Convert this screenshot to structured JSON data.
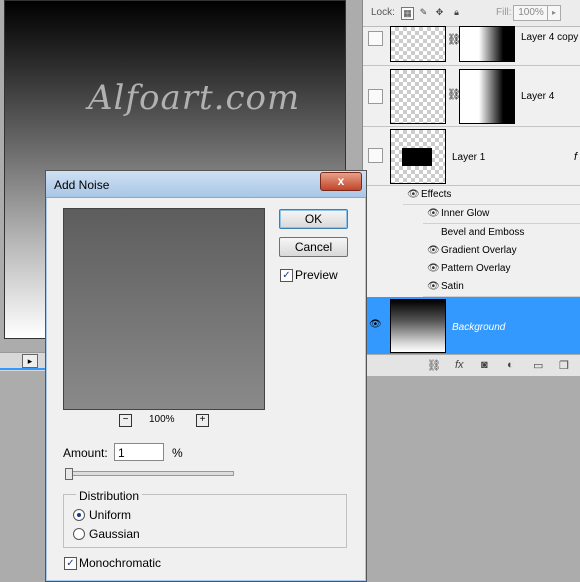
{
  "canvas": {
    "watermark": "Alfoart.com"
  },
  "layers_panel": {
    "lock_label": "Lock:",
    "fill_label": "Fill:",
    "fill_value": "100%",
    "layers": [
      {
        "name": "Layer 4 copy"
      },
      {
        "name": "Layer 4"
      },
      {
        "name": "Layer 1"
      },
      {
        "name": "Background"
      }
    ],
    "effects_label": "Effects",
    "effects": [
      "Inner Glow",
      "Bevel and Emboss",
      "Gradient Overlay",
      "Pattern Overlay",
      "Satin"
    ],
    "bottom_icons": [
      "link-icon",
      "fx-icon",
      "mask-icon",
      "adjustment-icon",
      "folder-icon",
      "new-layer-icon"
    ],
    "fx_text": "fx"
  },
  "dialog": {
    "title": "Add Noise",
    "close_symbol": "x",
    "ok_label": "OK",
    "cancel_label": "Cancel",
    "preview_label": "Preview",
    "preview_checked": true,
    "zoom_out": "−",
    "zoom_in": "+",
    "zoom_level": "100%",
    "amount_label": "Amount:",
    "amount_value": "1",
    "amount_unit": "%",
    "distribution_label": "Distribution",
    "distribution_options": [
      "Uniform",
      "Gaussian"
    ],
    "distribution_selected": "Uniform",
    "monochromatic_label": "Monochromatic",
    "monochromatic_checked": true
  },
  "colors": {
    "selection": "#3399ff",
    "dialog_bg": "#f0f0f0"
  }
}
